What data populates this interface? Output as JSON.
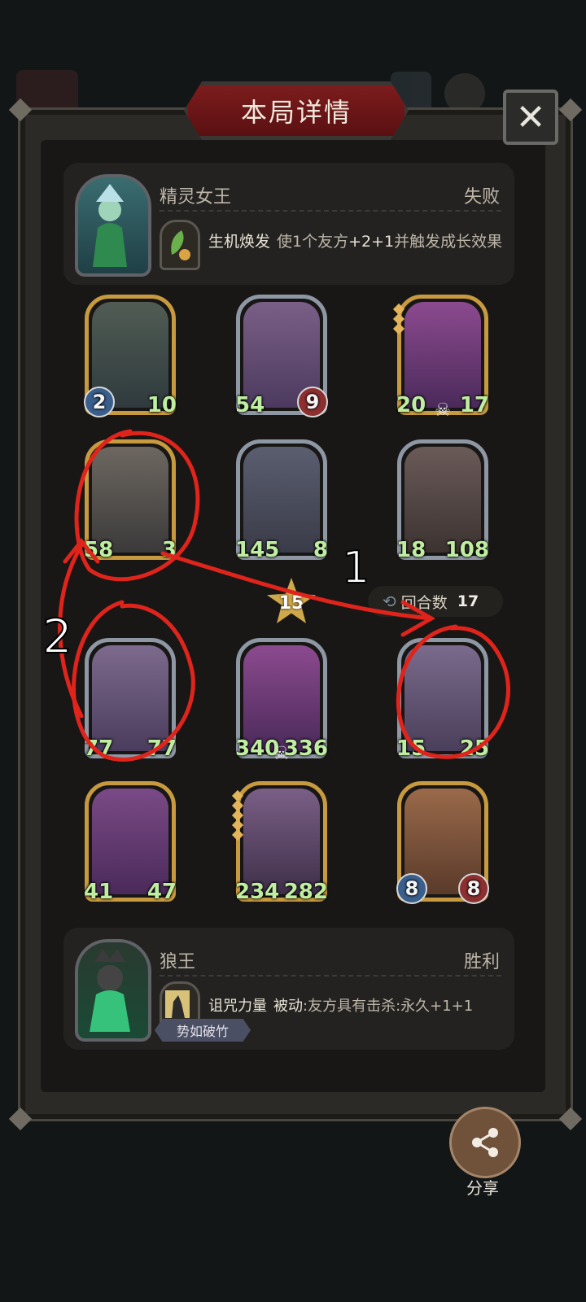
{
  "dialog": {
    "title": "本局详情",
    "close_label": "✕"
  },
  "top_hero": {
    "name": "精灵女王",
    "result": "失败",
    "skill_name": "生机焕发",
    "skill_desc_pre": "使1个友方",
    "skill_desc_bold": "+2+1",
    "skill_desc_post": "并触发成长效果"
  },
  "units": [
    {
      "atk": "2",
      "hp": "10",
      "frame": "gold",
      "style": "plain"
    },
    {
      "atk": "54",
      "hp": "9",
      "frame": "silver",
      "style": "green-atk"
    },
    {
      "atk": "20",
      "hp": "17",
      "frame": "gold",
      "style": "green",
      "skull": "☠"
    },
    {
      "atk": "58",
      "hp": "3",
      "frame": "gold",
      "style": "green"
    },
    {
      "atk": "145",
      "hp": "8",
      "frame": "silver",
      "style": "green"
    },
    {
      "atk": "18",
      "hp": "108",
      "frame": "silver",
      "style": "green"
    },
    {
      "atk": "77",
      "hp": "77",
      "frame": "silver",
      "style": "green"
    },
    {
      "atk": "340",
      "hp": "336",
      "frame": "silver",
      "style": "green",
      "skull": "☠"
    },
    {
      "atk": "15",
      "hp": "25",
      "frame": "silver",
      "style": "green"
    },
    {
      "atk": "41",
      "hp": "47",
      "frame": "gold",
      "style": "green"
    },
    {
      "atk": "234",
      "hp": "282",
      "frame": "gold",
      "style": "green"
    },
    {
      "atk": "8",
      "hp": "8",
      "frame": "gold",
      "style": "plain"
    }
  ],
  "center_badge": "15",
  "round": {
    "label": "回合数",
    "value": "17"
  },
  "bottom_hero": {
    "name": "狼王",
    "result": "胜利",
    "skill_name": "诅咒力量",
    "skill_desc_bold": "被动",
    "skill_desc_post": ":友方具有击杀:永久+1+1",
    "badge": "势如破竹"
  },
  "share_label": "分享",
  "annotations": {
    "label_1": "1",
    "label_2": "2",
    "color": "#e0241b"
  }
}
